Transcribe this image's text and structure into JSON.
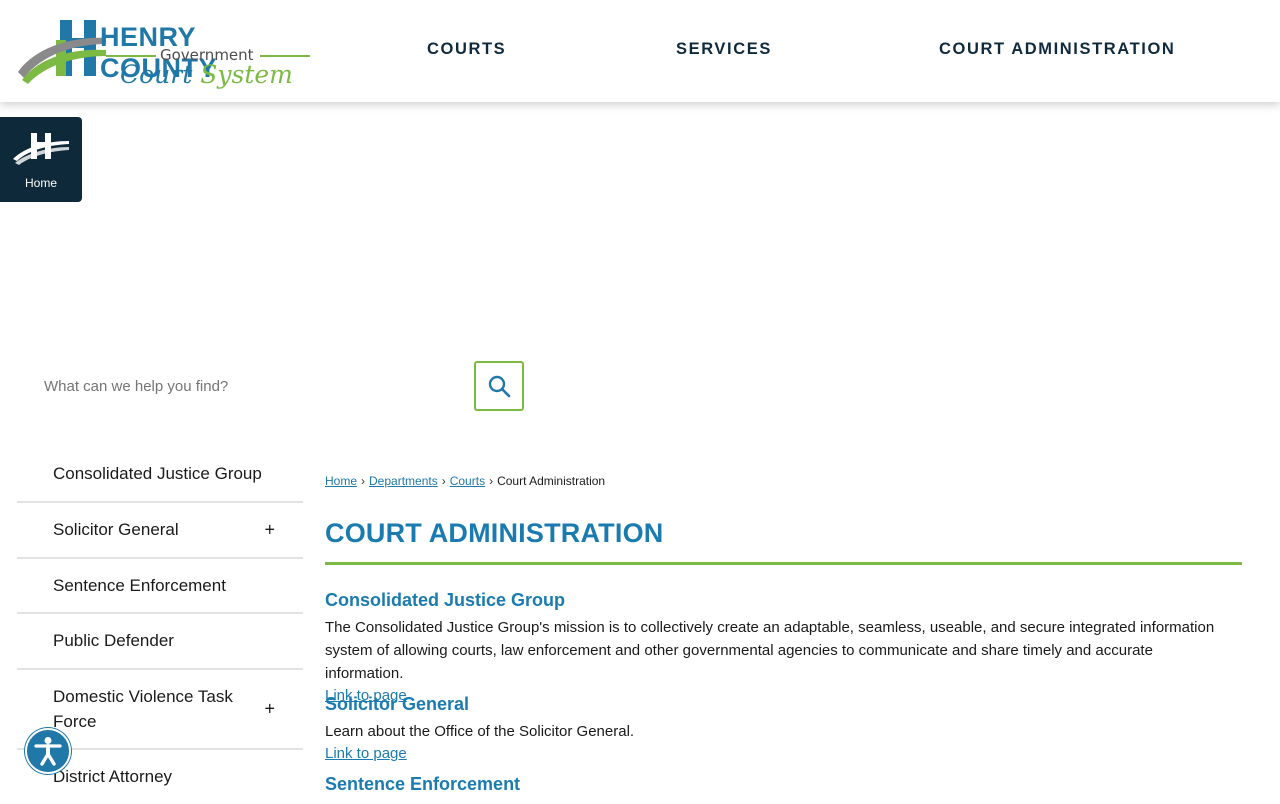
{
  "header": {
    "logo": {
      "title": "HENRY COUNTY",
      "subtitle": "Government",
      "court": "Court",
      "system": "System"
    },
    "nav": [
      {
        "label": "COURTS"
      },
      {
        "label": "SERVICES"
      },
      {
        "label": "COURT ADMINISTRATION"
      }
    ]
  },
  "home_tile": {
    "label": "Home"
  },
  "search": {
    "placeholder": "What can we help you find?"
  },
  "sidebar": {
    "items": [
      {
        "label": "Consolidated Justice Group",
        "expandable": false
      },
      {
        "label": "Solicitor General",
        "expandable": true
      },
      {
        "label": "Sentence Enforcement",
        "expandable": false
      },
      {
        "label": "Public Defender",
        "expandable": false
      },
      {
        "label": "Domestic Violence Task Force",
        "expandable": true
      },
      {
        "label": "District Attorney",
        "expandable": false
      }
    ],
    "expand_symbol": "+"
  },
  "breadcrumb": {
    "items": [
      "Home",
      "Departments",
      "Courts"
    ],
    "current": "Court Administration",
    "separator": "›"
  },
  "page_title": "COURT ADMINISTRATION",
  "sections": [
    {
      "title": "Consolidated Justice Group",
      "description": "The Consolidated Justice Group's mission is to collectively create an adaptable, seamless, useable, and secure integrated information system of allowing courts, law enforcement and other governmental agencies to communicate and share timely and accurate information.",
      "link": "Link to page"
    },
    {
      "title": "Solicitor General",
      "description": "Learn about the Office of the Solicitor General.",
      "link": "Link to page"
    },
    {
      "title": "Sentence Enforcement"
    }
  ],
  "icons": {
    "search": "search-icon",
    "home": "henry-h-logo-icon",
    "accessibility": "accessibility-icon"
  },
  "colors": {
    "brand_blue": "#1a7bb0",
    "brand_green": "#7dba43",
    "navy": "#0e2a3a"
  }
}
